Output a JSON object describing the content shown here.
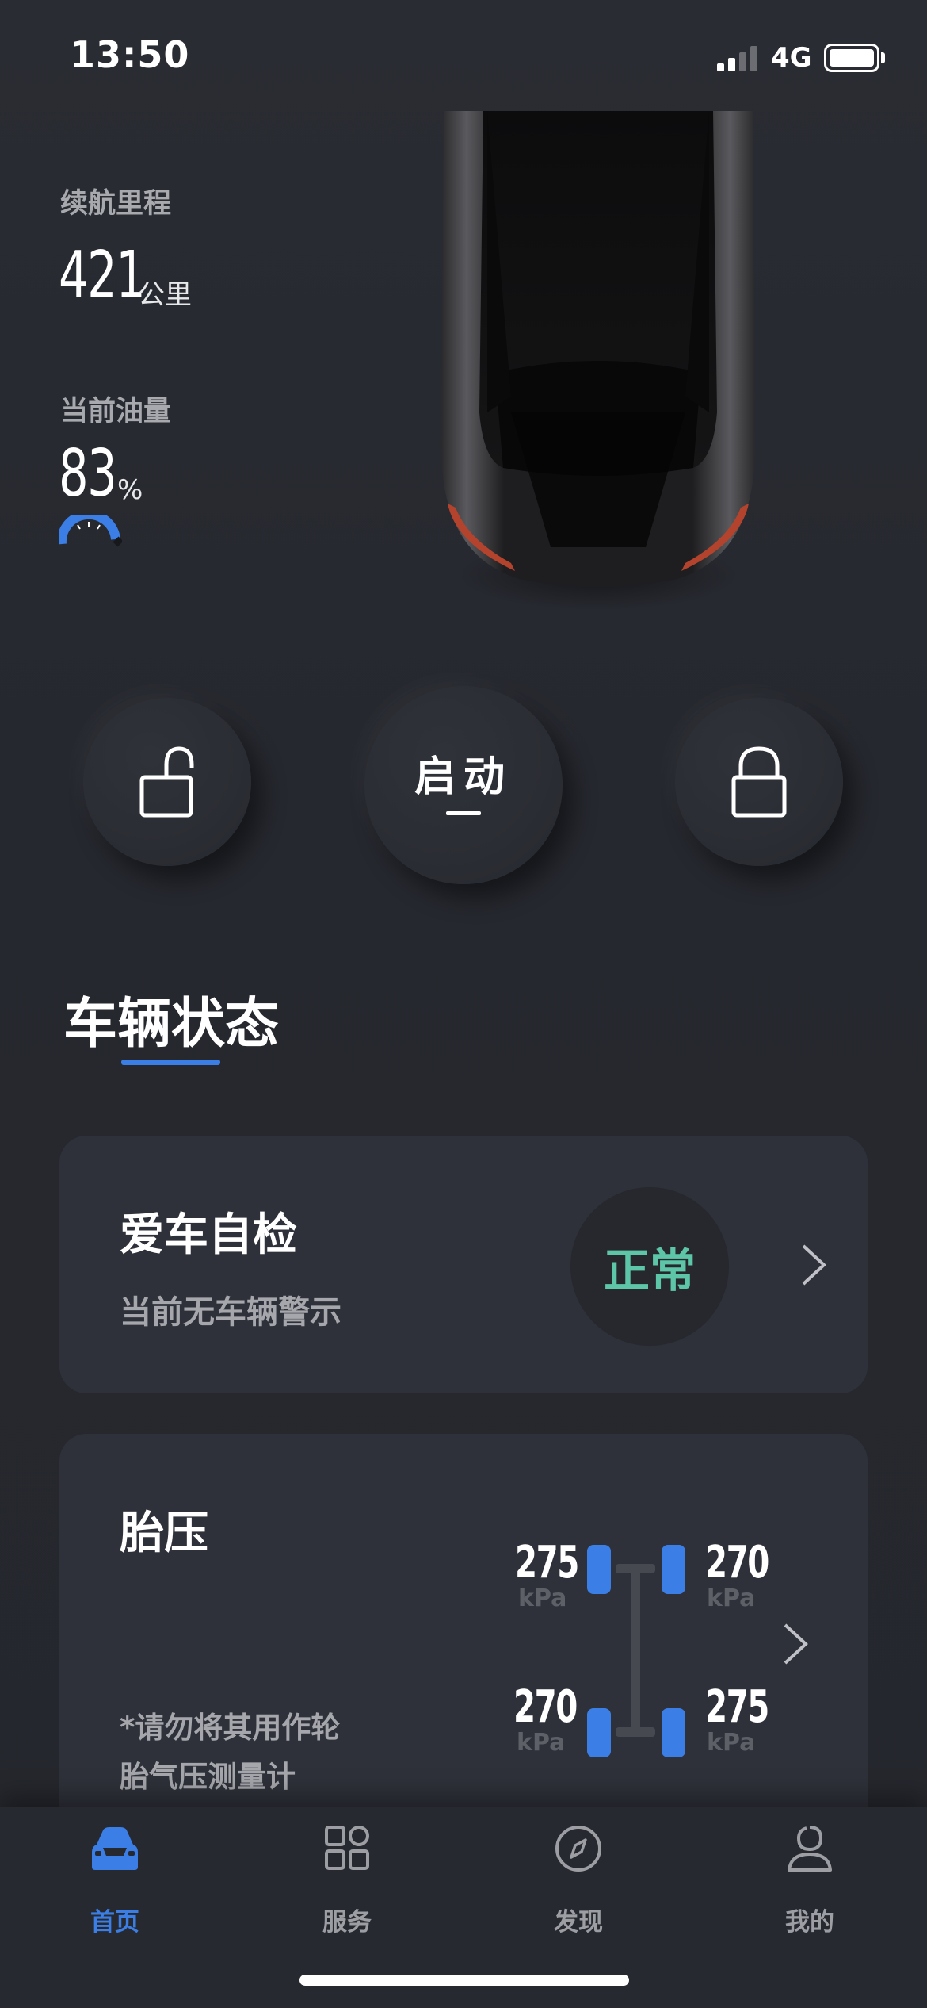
{
  "status_bar": {
    "time": "13:50",
    "network": "4G"
  },
  "stats": {
    "range_label": "续航里程",
    "range_value": "421",
    "range_unit": "公里",
    "fuel_label": "当前油量",
    "fuel_value": "83",
    "fuel_unit": "%",
    "fuel_level": 0.83
  },
  "controls": {
    "start_label": "启动",
    "unlock_icon": "unlock-icon",
    "lock_icon": "lock-icon"
  },
  "section": {
    "title": "车辆状态"
  },
  "self_check": {
    "title": "爱车自检",
    "subtitle": "当前无车辆警示",
    "status": "正常",
    "status_color": "#5ec6a8"
  },
  "tire_pressure": {
    "title": "胎压",
    "note_line1": "*请勿将其用作轮",
    "note_line2": "胎气压测量计",
    "front_left": "275",
    "front_right": "270",
    "rear_left": "270",
    "rear_right": "275",
    "unit": "kPa"
  },
  "nav": {
    "items": [
      {
        "label": "首页",
        "icon": "car-icon",
        "active": true
      },
      {
        "label": "服务",
        "icon": "grid-icon",
        "active": false
      },
      {
        "label": "发现",
        "icon": "compass-icon",
        "active": false
      },
      {
        "label": "我的",
        "icon": "user-icon",
        "active": false
      }
    ]
  },
  "colors": {
    "accent": "#3b7fe6",
    "card": "#2f313a",
    "background": "#25272e"
  }
}
